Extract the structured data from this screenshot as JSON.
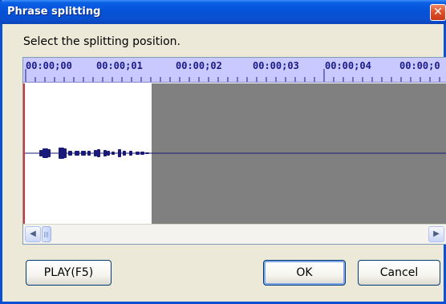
{
  "window": {
    "title": "Phrase splitting",
    "close_glyph": "✕"
  },
  "prompt": "Select the splitting position.",
  "timeline": {
    "ruler_labels": [
      "00:00;00",
      "00:00;01",
      "00:00;02",
      "00:00;03",
      "00:00;04",
      "00:00;0"
    ],
    "waveform_color": "#1a1a7a",
    "selection_color": "#ffffff",
    "background_color": "#808080",
    "marker_color": "#e03030",
    "ruler_color": "#c9c9ff"
  },
  "scrollbar": {
    "left_icon": "arrow-left-icon",
    "right_icon": "arrow-right-icon",
    "left_glyph": "◀",
    "right_glyph": "▶"
  },
  "buttons": {
    "play_label": "PLAY(F5)",
    "ok_label": "OK",
    "cancel_label": "Cancel"
  }
}
